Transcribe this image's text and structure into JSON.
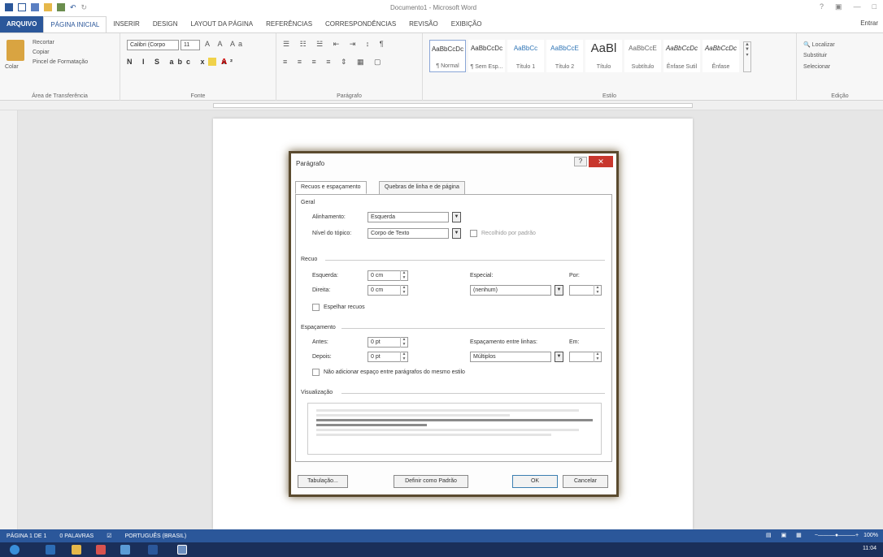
{
  "window": {
    "title": "Documento1 - Microsoft Word",
    "user": "Entrar"
  },
  "tabs": [
    "ARQUIVO",
    "PÁGINA INICIAL",
    "INSERIR",
    "DESIGN",
    "LAYOUT DA PÁGINA",
    "REFERÊNCIAS",
    "CORRESPONDÊNCIAS",
    "REVISÃO",
    "EXIBIÇÃO"
  ],
  "ribbon": {
    "clipboard": {
      "paste": "Colar",
      "cut": "Recortar",
      "copy": "Copiar",
      "format_painter": "Pincel de Formatação",
      "label": "Área de Transferência"
    },
    "font": {
      "name": "Calibri (Corpo",
      "size": "11",
      "label": "Fonte"
    },
    "paragraph": {
      "label": "Parágrafo"
    },
    "styles": {
      "label": "Estilo",
      "items": [
        {
          "preview": "AaBbCcDc",
          "name": "¶ Normal"
        },
        {
          "preview": "AaBbCcDc",
          "name": "¶ Sem Esp..."
        },
        {
          "preview": "AaBbCc",
          "name": "Título 1"
        },
        {
          "preview": "AaBbCcE",
          "name": "Título 2"
        },
        {
          "preview": "AaBl",
          "name": "Título"
        },
        {
          "preview": "AaBbCcE",
          "name": "Subtítulo"
        },
        {
          "preview": "AaBbCcDc",
          "name": "Ênfase Sutil"
        },
        {
          "preview": "AaBbCcDc",
          "name": "Ênfase"
        }
      ]
    },
    "editing": {
      "find": "Localizar",
      "replace": "Substituir",
      "select": "Selecionar",
      "label": "Edição"
    }
  },
  "dialog": {
    "title": "Parágrafo",
    "tab_indent": "Recuos e espaçamento",
    "tab_breaks": "Quebras de linha e de página",
    "general": {
      "heading": "Geral",
      "alignment_label": "Alinhamento:",
      "alignment_value": "Esquerda",
      "level_label": "Nível do tópico:",
      "level_value": "Corpo de Texto",
      "collapsed_label": "Recolhido por padrão"
    },
    "indent": {
      "heading": "Recuo",
      "left_label": "Esquerda:",
      "left_value": "0 cm",
      "right_label": "Direita:",
      "right_value": "0 cm",
      "special_label": "Especial:",
      "special_value": "(nenhum)",
      "by_label": "Por:",
      "mirror_label": "Espelhar recuos"
    },
    "spacing": {
      "heading": "Espaçamento",
      "before_label": "Antes:",
      "before_value": "0 pt",
      "after_label": "Depois:",
      "after_value": "0 pt",
      "line_label": "Espaçamento entre linhas:",
      "line_value": "Múltiplos",
      "at_label": "Em:",
      "no_space_label": "Não adicionar espaço entre parágrafos do mesmo estilo"
    },
    "preview_heading": "Visualização",
    "buttons": {
      "tabs": "Tabulação...",
      "default": "Definir como Padrão",
      "ok": "OK",
      "cancel": "Cancelar"
    }
  },
  "status": {
    "page": "PÁGINA 1 DE 1",
    "words": "0 PALAVRAS",
    "language": "PORTUGUÊS (BRASIL)",
    "zoom": "100%",
    "time": "11:04"
  }
}
